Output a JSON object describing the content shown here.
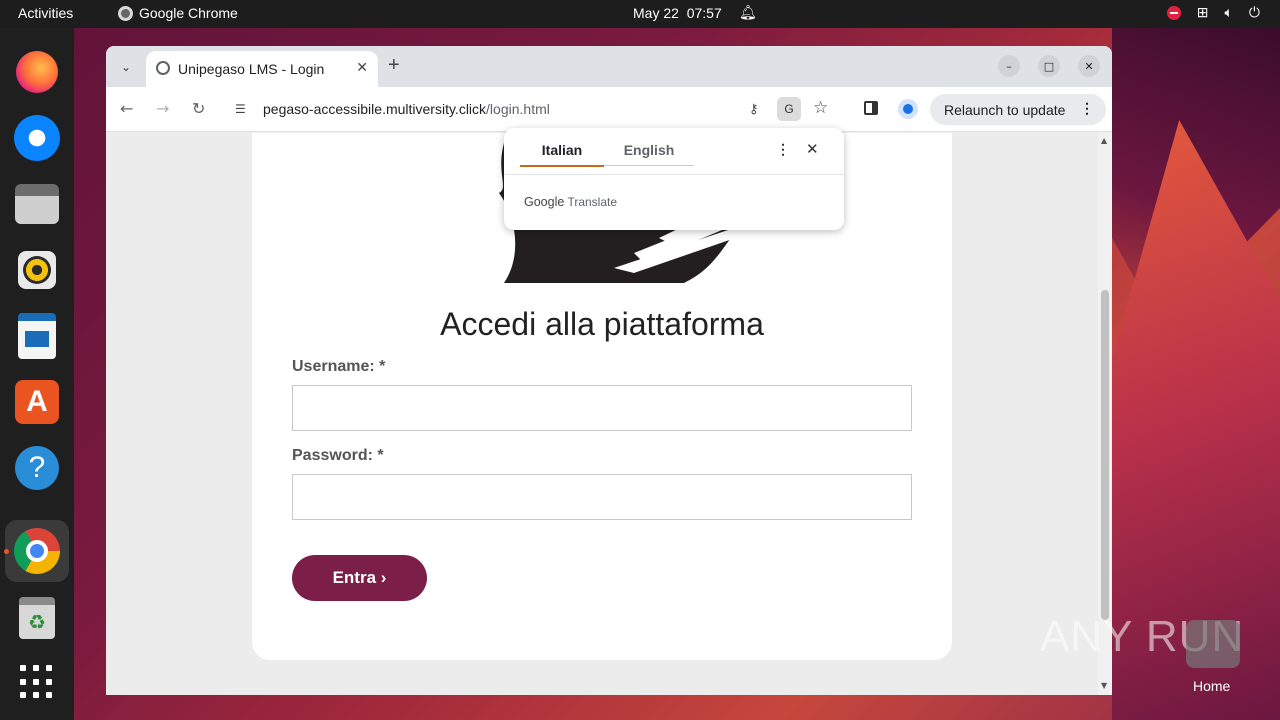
{
  "topbar": {
    "activities": "Activities",
    "app_name": "Google Chrome",
    "date": "May 22",
    "time": "07:57"
  },
  "dock": {
    "items": [
      "firefox-icon",
      "thunderbird-icon",
      "files-icon",
      "rhythmbox-icon",
      "writer-icon",
      "app-center-icon",
      "help-icon",
      "chrome-icon",
      "trash-icon",
      "show-apps-icon"
    ],
    "active": "chrome-icon"
  },
  "browser": {
    "tab_title": "Unipegaso LMS - Login",
    "url_host": "pegaso-accessibile.multiversity.click",
    "url_path": "/login.html",
    "relaunch_label": "Relaunch to update"
  },
  "translate": {
    "source_lang": "Italian",
    "target_lang": "English",
    "brand_google": "Google",
    "brand_translate": "Translate"
  },
  "page": {
    "heading": "Accedi alla piattaforma",
    "username_label": "Username: *",
    "username_value": "",
    "password_label": "Password: *",
    "password_value": "",
    "submit_label": "Entra ›"
  },
  "desktop": {
    "watermark": "ANY RUN",
    "home_label": "Home"
  },
  "colors": {
    "accent_button": "#7b1f49",
    "translate_underline": "#c66a1e",
    "ubuntu_orange": "#e95420"
  }
}
